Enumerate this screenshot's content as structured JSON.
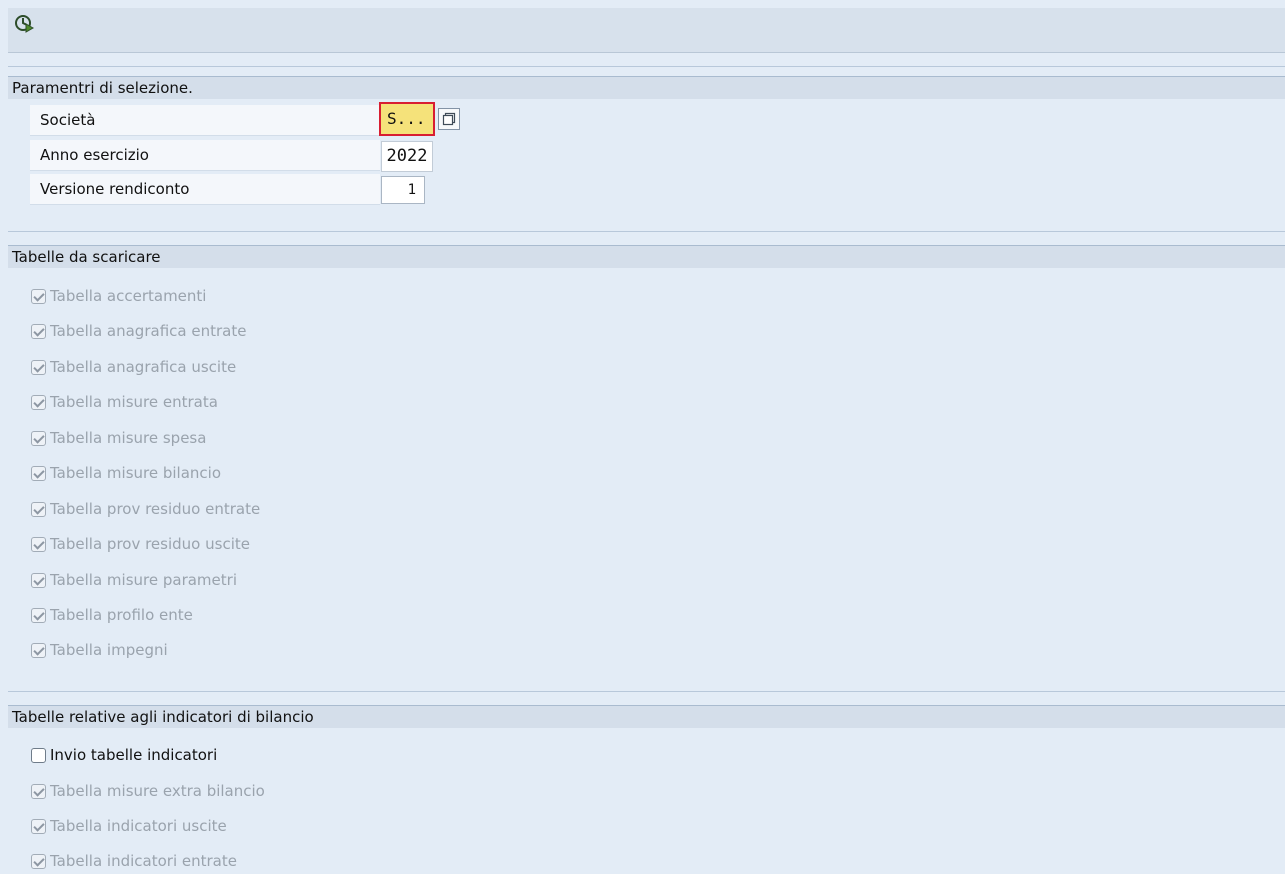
{
  "sections": {
    "selection_title": "Paramentri di selezione.",
    "tables_title": "Tabelle da scaricare",
    "indicators_title": "Tabelle relative agli indicatori di bilancio"
  },
  "params": {
    "company": {
      "label": "Società",
      "value": "S..."
    },
    "fiscal_year": {
      "label": "Anno esercizio",
      "value": "2022"
    },
    "report_version": {
      "label": "Versione rendiconto",
      "value": "1"
    }
  },
  "tables": [
    "Tabella accertamenti",
    "Tabella anagrafica entrate",
    "Tabella anagrafica uscite",
    "Tabella misure entrata",
    "Tabella misure spesa",
    "Tabella misure bilancio",
    "Tabella prov residuo entrate",
    "Tabella prov residuo uscite",
    "Tabella misure parametri",
    "Tabella profilo ente",
    "Tabella impegni"
  ],
  "indicators": {
    "send_label": "Invio tabelle indicatori",
    "send_checked": false,
    "items": [
      "Tabella misure extra bilancio",
      "Tabella indicatori uscite",
      "Tabella indicatori entrate"
    ]
  },
  "icons": {
    "execute": "execute-icon",
    "value_help": "value-help-icon"
  }
}
